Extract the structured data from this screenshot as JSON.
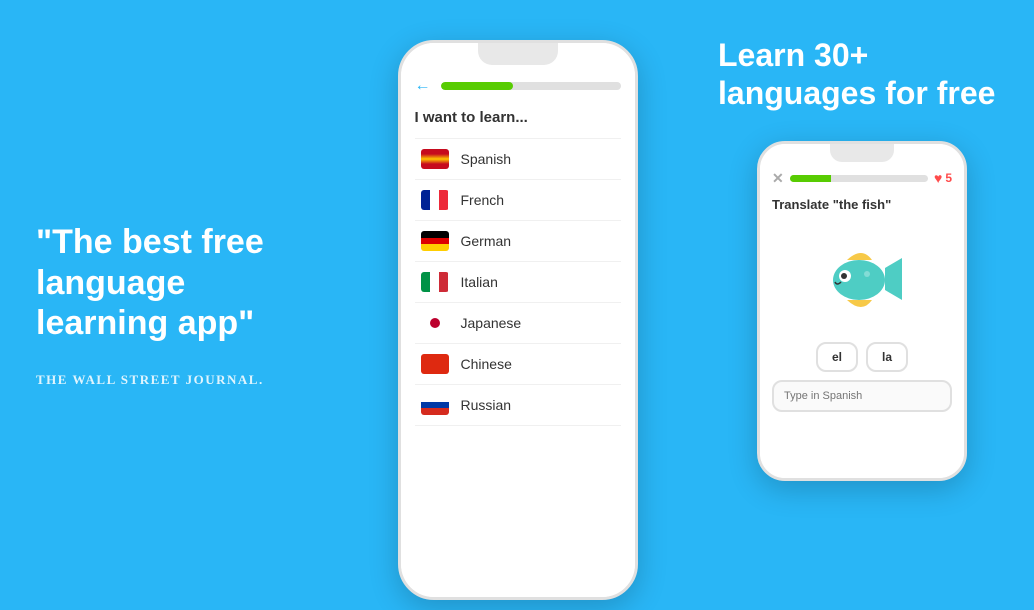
{
  "left": {
    "quote": "\"The best free language learning app\"",
    "attribution": "THE WALL STREET JOURNAL."
  },
  "center": {
    "learn_title": "I want to learn...",
    "languages": [
      {
        "name": "Spanish",
        "flag": "spain"
      },
      {
        "name": "French",
        "flag": "france"
      },
      {
        "name": "German",
        "flag": "germany"
      },
      {
        "name": "Italian",
        "flag": "italy"
      },
      {
        "name": "Japanese",
        "flag": "japan"
      },
      {
        "name": "Chinese",
        "flag": "china"
      },
      {
        "name": "Russian",
        "flag": "russia"
      }
    ],
    "progress_pct": 40
  },
  "right": {
    "headline": "Learn 30+ languages for free",
    "translate_prompt": "Translate \"the fish\"",
    "word_buttons": [
      "el",
      "la"
    ],
    "type_placeholder": "Type in Spanish",
    "hearts": "5",
    "progress_pct": 30
  },
  "colors": {
    "blue_bg": "#29b6f6",
    "green": "#58cc02",
    "red_heart": "#ff4b4b"
  }
}
